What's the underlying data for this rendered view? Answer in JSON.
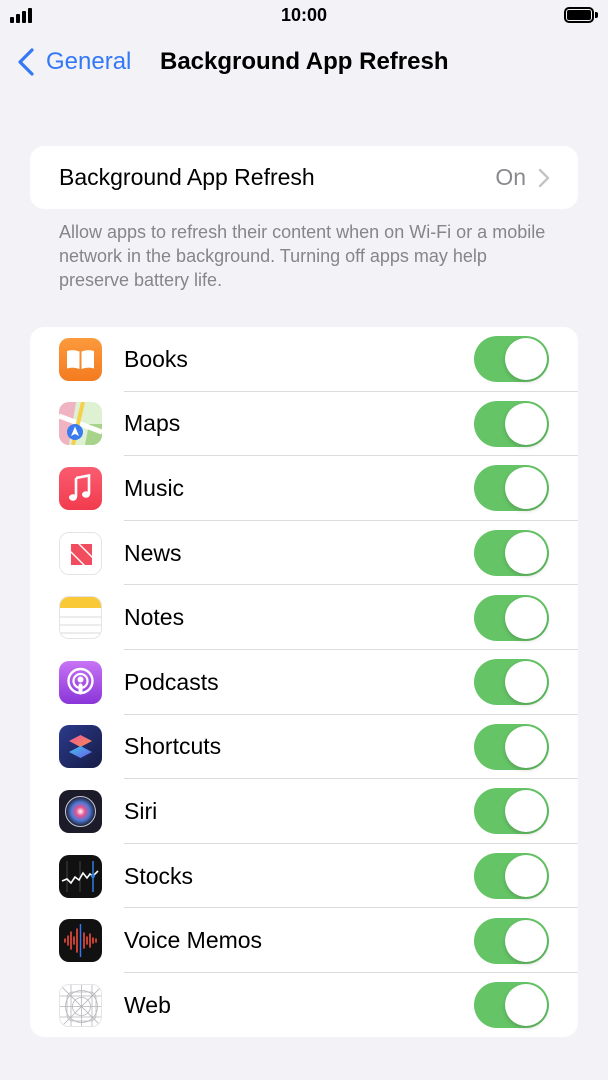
{
  "status_bar": {
    "time": "10:00"
  },
  "nav": {
    "back_label": "General",
    "title": "Background App Refresh"
  },
  "refresh_setting": {
    "label": "Background App Refresh",
    "value": "On"
  },
  "footnote": "Allow apps to refresh their content when on Wi-Fi or a mobile network in the background. Turning off apps may help preserve battery life.",
  "colors": {
    "accent": "#3478f6",
    "toggle_on": "#65c466",
    "background": "#f2f2f7"
  },
  "apps": [
    {
      "name": "Books",
      "icon": "books-icon",
      "enabled": true
    },
    {
      "name": "Maps",
      "icon": "maps-icon",
      "enabled": true
    },
    {
      "name": "Music",
      "icon": "music-icon",
      "enabled": true
    },
    {
      "name": "News",
      "icon": "news-icon",
      "enabled": true
    },
    {
      "name": "Notes",
      "icon": "notes-icon",
      "enabled": true
    },
    {
      "name": "Podcasts",
      "icon": "podcasts-icon",
      "enabled": true
    },
    {
      "name": "Shortcuts",
      "icon": "shortcuts-icon",
      "enabled": true
    },
    {
      "name": "Siri",
      "icon": "siri-icon",
      "enabled": true
    },
    {
      "name": "Stocks",
      "icon": "stocks-icon",
      "enabled": true
    },
    {
      "name": "Voice Memos",
      "icon": "voice-memos-icon",
      "enabled": true
    },
    {
      "name": "Web",
      "icon": "web-icon",
      "enabled": true
    }
  ]
}
